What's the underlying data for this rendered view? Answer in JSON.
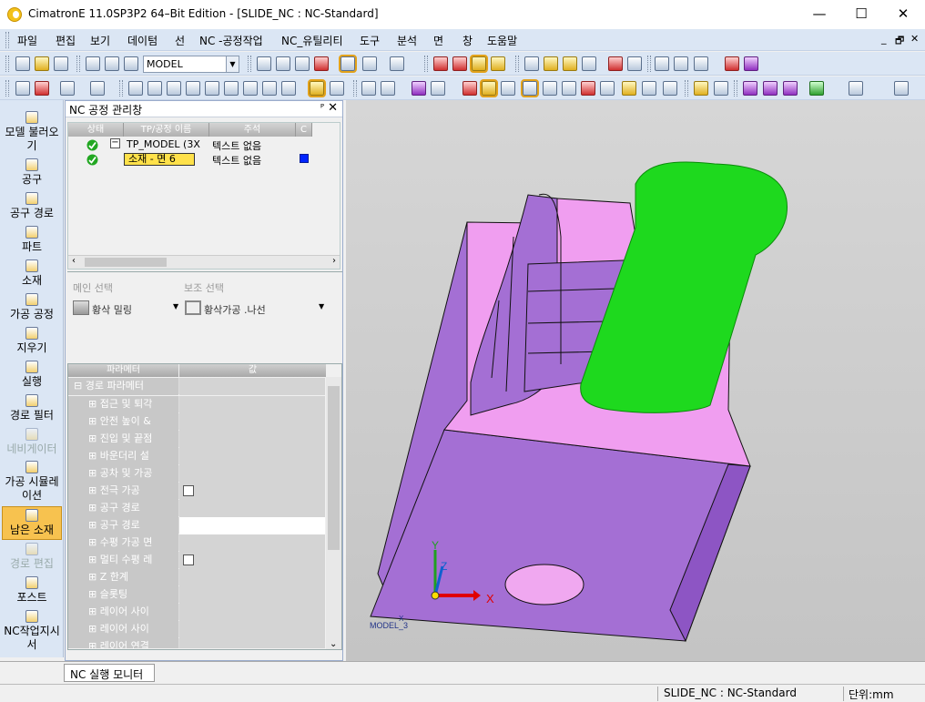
{
  "window": {
    "title": "CimatronE 11.0SP3P2 64–Bit Edition - [SLIDE_NC : NC-Standard]",
    "minimize": "—",
    "maximize": "☐",
    "close": "✕"
  },
  "menu": {
    "items": [
      "파일",
      "편집",
      "보기",
      "데이텀",
      "선",
      "NC -공정작업",
      "NC_유틸리티",
      "도구",
      "분석",
      "면",
      "창",
      "도움말"
    ],
    "mdi": [
      "_",
      "🗗",
      "✕"
    ]
  },
  "toolbar": {
    "model_combo": "MODEL"
  },
  "left_bar": {
    "items": [
      {
        "label": "모델 불러오기",
        "icon": "model-load-icon"
      },
      {
        "label": "공구",
        "icon": "tool-icon"
      },
      {
        "label": "공구 경로",
        "icon": "toolpath-icon"
      },
      {
        "label": "파트",
        "icon": "part-icon"
      },
      {
        "label": "소재",
        "icon": "stock-icon"
      },
      {
        "label": "가공 공정",
        "icon": "procedure-icon"
      },
      {
        "label": "지우기",
        "icon": "delete-icon"
      },
      {
        "label": "실행",
        "icon": "run-icon"
      },
      {
        "label": "경로 필터",
        "icon": "path-filter-icon"
      },
      {
        "label": "네비게이터",
        "icon": "navigator-icon",
        "disabled": true
      },
      {
        "label": "가공 시뮬레이션",
        "icon": "simulation-icon"
      },
      {
        "label": "남은 소재",
        "icon": "remaining-stock-icon",
        "selected": true
      },
      {
        "label": "경로 편집",
        "icon": "path-edit-icon",
        "disabled": true
      },
      {
        "label": "포스트",
        "icon": "post-icon"
      },
      {
        "label": "NC작업지시서",
        "icon": "nc-worksheet-icon"
      }
    ]
  },
  "nc_manager": {
    "title": "NC 공정 관리창",
    "pin": "ᴾ",
    "close": "✕",
    "columns": [
      "상태",
      "TP/공정 이름",
      "주석",
      "C"
    ],
    "rows": [
      {
        "name": "TP_MODEL (3X",
        "comment": "텍스트 없음",
        "expander": "−"
      },
      {
        "name": "소재 - 면 6",
        "comment": "텍스트 없음",
        "color": "#0024ff"
      }
    ]
  },
  "selection": {
    "main_label": "메인 선택",
    "main_value": "황삭 밀링",
    "sub_label": "보조 선택",
    "sub_value": "황삭가공 .나선"
  },
  "params": {
    "col_name": "파라메터",
    "col_value": "값",
    "group": "경로 파라메터",
    "rows": [
      {
        "name": "접근 및 퇴각"
      },
      {
        "name": "안전 높이 &"
      },
      {
        "name": "진입 및 끝점"
      },
      {
        "name": "바운더리 설"
      },
      {
        "name": "공차 및 가공"
      },
      {
        "name": "전극 가공",
        "checkbox": true
      },
      {
        "name": "공구 경로"
      },
      {
        "name": "공구 경로",
        "white": true
      },
      {
        "name": "수평 가공 면"
      },
      {
        "name": "멀티 수평 레",
        "checkbox": true
      },
      {
        "name": "Z 한계"
      },
      {
        "name": "슬롯팅"
      },
      {
        "name": "레이어 사이"
      },
      {
        "name": "레이어 사이"
      },
      {
        "name": "레이어 연결"
      }
    ]
  },
  "viewport": {
    "axis_x": "X",
    "axis_y": "Y",
    "axis_z": "Z",
    "model_label": "MODEL_3",
    "small_axis": "X"
  },
  "bottom": {
    "tab": "NC 실행 모니터"
  },
  "status": {
    "doc": "SLIDE_NC : NC-Standard",
    "units": "단위:mm"
  },
  "colors": {
    "body": "#a46fd4",
    "top_face": "#f09ef0",
    "handle": "#1ed91e",
    "hole": "#f0a8f0",
    "x_axis": "#e00000",
    "y_axis": "#20a020",
    "z_axis": "#1060d0"
  }
}
